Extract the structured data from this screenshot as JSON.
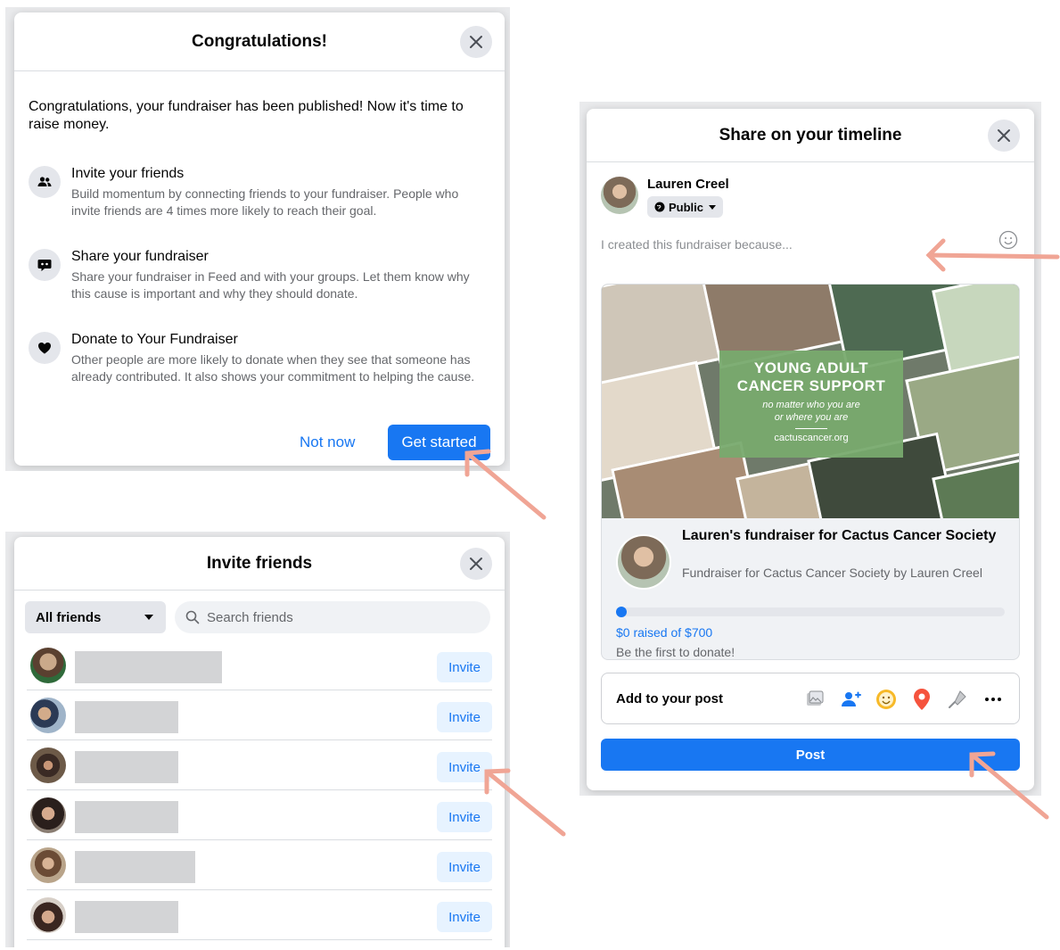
{
  "congrats": {
    "title": "Congratulations!",
    "intro": "Congratulations, your fundraiser has been published! Now it's time to raise money.",
    "features": [
      {
        "icon": "people-icon",
        "title": "Invite your friends",
        "desc": "Build momentum by connecting friends to your fundraiser. People who invite friends are 4 times more likely to reach their goal."
      },
      {
        "icon": "speech-bubble-icon",
        "title": "Share your fundraiser",
        "desc": "Share your fundraiser in Feed and with your groups. Let them know why this cause is important and why they should donate."
      },
      {
        "icon": "heart-icon",
        "title": "Donate to Your Fundraiser",
        "desc": "Other people are more likely to donate when they see that someone has already contributed. It also shows your commitment to helping the cause."
      }
    ],
    "secondary_label": "Not now",
    "primary_label": "Get started"
  },
  "invite": {
    "title": "Invite friends",
    "filter_label": "All friends",
    "search_placeholder": "Search friends",
    "invite_label": "Invite",
    "friend_count": 6
  },
  "share": {
    "title": "Share on your timeline",
    "poster_name": "Lauren Creel",
    "audience_label": "Public",
    "composer_placeholder": "I created this fundraiser because...",
    "banner": {
      "line1": "YOUNG ADULT",
      "line2": "CANCER SUPPORT",
      "tagline1": "no matter who you are",
      "tagline2": "or where you are",
      "url": "cactuscancer.org"
    },
    "fundraiser_title": "Lauren's fundraiser for Cactus Cancer Society",
    "fundraiser_subtitle": "Fundraiser for Cactus Cancer Society by Lauren Creel",
    "raised_text": "$0 raised of $700",
    "raised_fraction": 0,
    "cta_text": "Be the first to donate!",
    "add_to_post_label": "Add to your post",
    "tools": [
      "photo-icon",
      "tag-people-icon",
      "feeling-icon",
      "location-icon",
      "mic-icon",
      "more-icon"
    ],
    "post_label": "Post"
  },
  "colors": {
    "brand_blue": "#1877f2",
    "arrow": "#f0a595"
  }
}
